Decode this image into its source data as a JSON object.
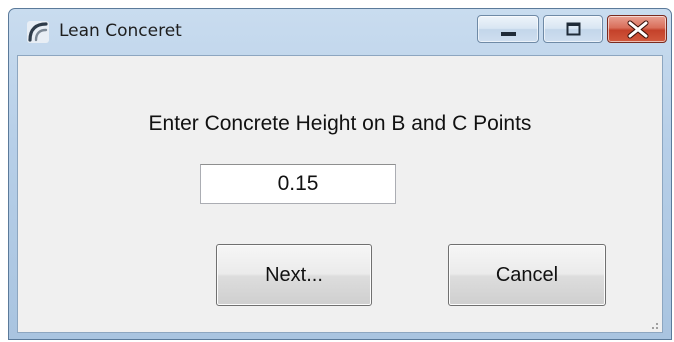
{
  "window": {
    "title": "Lean Conceret",
    "icon": "app-curve-icon",
    "controls": {
      "minimize_icon": "minimize-icon",
      "maximize_icon": "maximize-icon",
      "close_icon": "close-icon"
    }
  },
  "dialog": {
    "prompt": "Enter Concrete Height on B and C Points",
    "height_value": "0.15",
    "next_label": "Next...",
    "cancel_label": "Cancel"
  },
  "colors": {
    "frame": "#b7cfe8",
    "client": "#f0f0f0",
    "close_button": "#c4412a"
  }
}
